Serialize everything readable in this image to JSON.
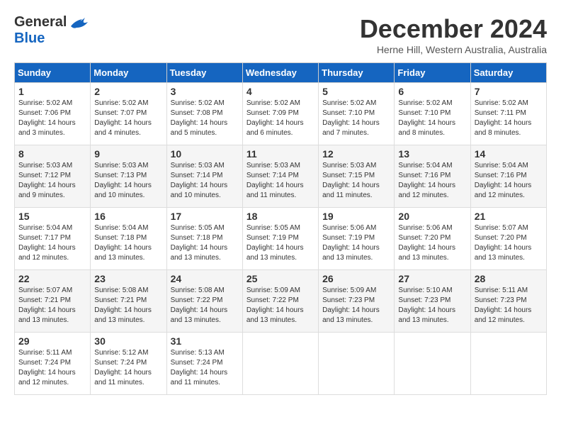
{
  "logo": {
    "general": "General",
    "blue": "Blue"
  },
  "title": "December 2024",
  "subtitle": "Herne Hill, Western Australia, Australia",
  "days_of_week": [
    "Sunday",
    "Monday",
    "Tuesday",
    "Wednesday",
    "Thursday",
    "Friday",
    "Saturday"
  ],
  "weeks": [
    [
      {
        "day": "1",
        "sunrise": "5:02 AM",
        "sunset": "7:06 PM",
        "daylight": "14 hours and 3 minutes."
      },
      {
        "day": "2",
        "sunrise": "5:02 AM",
        "sunset": "7:07 PM",
        "daylight": "14 hours and 4 minutes."
      },
      {
        "day": "3",
        "sunrise": "5:02 AM",
        "sunset": "7:08 PM",
        "daylight": "14 hours and 5 minutes."
      },
      {
        "day": "4",
        "sunrise": "5:02 AM",
        "sunset": "7:09 PM",
        "daylight": "14 hours and 6 minutes."
      },
      {
        "day": "5",
        "sunrise": "5:02 AM",
        "sunset": "7:10 PM",
        "daylight": "14 hours and 7 minutes."
      },
      {
        "day": "6",
        "sunrise": "5:02 AM",
        "sunset": "7:10 PM",
        "daylight": "14 hours and 8 minutes."
      },
      {
        "day": "7",
        "sunrise": "5:02 AM",
        "sunset": "7:11 PM",
        "daylight": "14 hours and 8 minutes."
      }
    ],
    [
      {
        "day": "8",
        "sunrise": "5:03 AM",
        "sunset": "7:12 PM",
        "daylight": "14 hours and 9 minutes."
      },
      {
        "day": "9",
        "sunrise": "5:03 AM",
        "sunset": "7:13 PM",
        "daylight": "14 hours and 10 minutes."
      },
      {
        "day": "10",
        "sunrise": "5:03 AM",
        "sunset": "7:14 PM",
        "daylight": "14 hours and 10 minutes."
      },
      {
        "day": "11",
        "sunrise": "5:03 AM",
        "sunset": "7:14 PM",
        "daylight": "14 hours and 11 minutes."
      },
      {
        "day": "12",
        "sunrise": "5:03 AM",
        "sunset": "7:15 PM",
        "daylight": "14 hours and 11 minutes."
      },
      {
        "day": "13",
        "sunrise": "5:04 AM",
        "sunset": "7:16 PM",
        "daylight": "14 hours and 12 minutes."
      },
      {
        "day": "14",
        "sunrise": "5:04 AM",
        "sunset": "7:16 PM",
        "daylight": "14 hours and 12 minutes."
      }
    ],
    [
      {
        "day": "15",
        "sunrise": "5:04 AM",
        "sunset": "7:17 PM",
        "daylight": "14 hours and 12 minutes."
      },
      {
        "day": "16",
        "sunrise": "5:04 AM",
        "sunset": "7:18 PM",
        "daylight": "14 hours and 13 minutes."
      },
      {
        "day": "17",
        "sunrise": "5:05 AM",
        "sunset": "7:18 PM",
        "daylight": "14 hours and 13 minutes."
      },
      {
        "day": "18",
        "sunrise": "5:05 AM",
        "sunset": "7:19 PM",
        "daylight": "14 hours and 13 minutes."
      },
      {
        "day": "19",
        "sunrise": "5:06 AM",
        "sunset": "7:19 PM",
        "daylight": "14 hours and 13 minutes."
      },
      {
        "day": "20",
        "sunrise": "5:06 AM",
        "sunset": "7:20 PM",
        "daylight": "14 hours and 13 minutes."
      },
      {
        "day": "21",
        "sunrise": "5:07 AM",
        "sunset": "7:20 PM",
        "daylight": "14 hours and 13 minutes."
      }
    ],
    [
      {
        "day": "22",
        "sunrise": "5:07 AM",
        "sunset": "7:21 PM",
        "daylight": "14 hours and 13 minutes."
      },
      {
        "day": "23",
        "sunrise": "5:08 AM",
        "sunset": "7:21 PM",
        "daylight": "14 hours and 13 minutes."
      },
      {
        "day": "24",
        "sunrise": "5:08 AM",
        "sunset": "7:22 PM",
        "daylight": "14 hours and 13 minutes."
      },
      {
        "day": "25",
        "sunrise": "5:09 AM",
        "sunset": "7:22 PM",
        "daylight": "14 hours and 13 minutes."
      },
      {
        "day": "26",
        "sunrise": "5:09 AM",
        "sunset": "7:23 PM",
        "daylight": "14 hours and 13 minutes."
      },
      {
        "day": "27",
        "sunrise": "5:10 AM",
        "sunset": "7:23 PM",
        "daylight": "14 hours and 13 minutes."
      },
      {
        "day": "28",
        "sunrise": "5:11 AM",
        "sunset": "7:23 PM",
        "daylight": "14 hours and 12 minutes."
      }
    ],
    [
      {
        "day": "29",
        "sunrise": "5:11 AM",
        "sunset": "7:24 PM",
        "daylight": "14 hours and 12 minutes."
      },
      {
        "day": "30",
        "sunrise": "5:12 AM",
        "sunset": "7:24 PM",
        "daylight": "14 hours and 11 minutes."
      },
      {
        "day": "31",
        "sunrise": "5:13 AM",
        "sunset": "7:24 PM",
        "daylight": "14 hours and 11 minutes."
      },
      null,
      null,
      null,
      null
    ]
  ]
}
